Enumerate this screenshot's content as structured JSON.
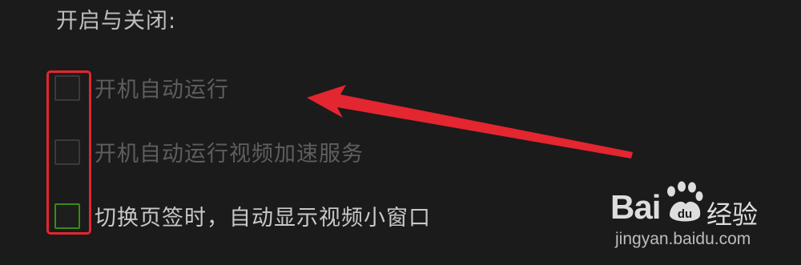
{
  "section": {
    "title": "开启与关闭:"
  },
  "options": [
    {
      "label": "开机自动运行",
      "checked": false,
      "enabled": false
    },
    {
      "label": "开机自动运行视频加速服务",
      "checked": false,
      "enabled": false
    },
    {
      "label": "切换页签时，自动显示视频小窗口",
      "checked": false,
      "enabled": true
    }
  ],
  "annotation": {
    "color": "#e3262f"
  },
  "watermark": {
    "brand": "Bai",
    "cn": "经验",
    "url": "jingyan.baidu.com"
  },
  "colors": {
    "background": "#1b1b1b",
    "checkbox_green": "#3c8a12",
    "text_dim": "#5e5e5e",
    "text_bright": "#c8c8c8"
  }
}
